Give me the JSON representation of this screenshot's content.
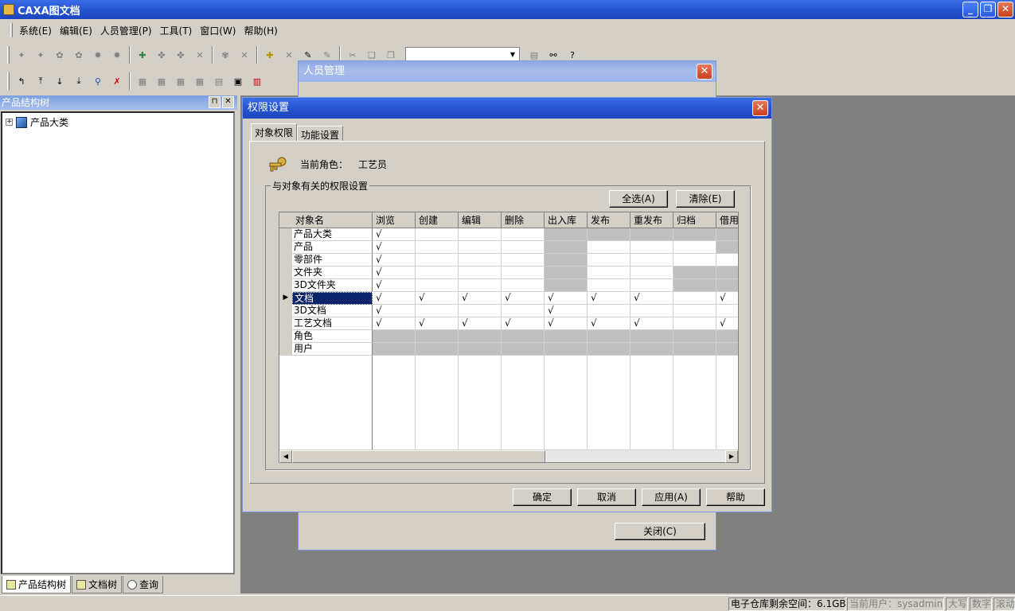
{
  "app": {
    "title": "CAXA图文档"
  },
  "menu": [
    "系统(E)",
    "编辑(E)",
    "人员管理(P)",
    "工具(T)",
    "窗口(W)",
    "帮助(H)"
  ],
  "left_panel": {
    "title": "产品结构树",
    "tree_root": "产品大类",
    "tabs": [
      "产品结构树",
      "文档树",
      "查询"
    ]
  },
  "status": {
    "free_space": "电子仓库剩余空间：6.1GB",
    "current_user": "当前用户：sysadmin",
    "caps": "大写",
    "num": "数字",
    "scroll": "滚动"
  },
  "people_dialog": {
    "title": "人员管理",
    "close_label": "关闭(C)"
  },
  "perm_dialog": {
    "title": "权限设置",
    "tabs": [
      "对象权限",
      "功能设置"
    ],
    "role_label": "当前角色：",
    "role_value": "工艺员",
    "group_label": "与对象有关的权限设置",
    "select_all": "全选(A)",
    "clear": "清除(E)",
    "ok": "确定",
    "cancel": "取消",
    "apply": "应用(A)",
    "help": "帮助"
  },
  "grid": {
    "name_header": "对象名",
    "columns": [
      "浏览",
      "创建",
      "编辑",
      "删除",
      "出入库",
      "发布",
      "重发布",
      "归档",
      "借用"
    ],
    "selected_row": 5,
    "rows": [
      {
        "name": "产品大类",
        "cells": [
          "√",
          "",
          "",
          "",
          "#",
          "#",
          "#",
          "#",
          "#"
        ]
      },
      {
        "name": "产品",
        "cells": [
          "√",
          "",
          "",
          "",
          "#",
          "",
          "",
          "",
          "#"
        ]
      },
      {
        "name": "零部件",
        "cells": [
          "√",
          "",
          "",
          "",
          "#",
          "",
          "",
          "",
          ""
        ]
      },
      {
        "name": "文件夹",
        "cells": [
          "√",
          "",
          "",
          "",
          "#",
          "",
          "",
          "#",
          "#"
        ]
      },
      {
        "name": "3D文件夹",
        "cells": [
          "√",
          "",
          "",
          "",
          "#",
          "",
          "",
          "#",
          "#"
        ]
      },
      {
        "name": "文档",
        "cells": [
          "√",
          "√",
          "√",
          "√",
          "√",
          "√",
          "√",
          "",
          "√"
        ]
      },
      {
        "name": "3D文档",
        "cells": [
          "√",
          "",
          "",
          "",
          "√",
          "",
          "",
          "",
          ""
        ]
      },
      {
        "name": "工艺文档",
        "cells": [
          "√",
          "√",
          "√",
          "√",
          "√",
          "√",
          "√",
          "",
          "√"
        ]
      },
      {
        "name": "角色",
        "cells": [
          "#",
          "#",
          "#",
          "#",
          "#",
          "#",
          "#",
          "#",
          "#"
        ]
      },
      {
        "name": "用户",
        "cells": [
          "#",
          "#",
          "#",
          "#",
          "#",
          "#",
          "#",
          "#",
          "#"
        ]
      }
    ]
  }
}
